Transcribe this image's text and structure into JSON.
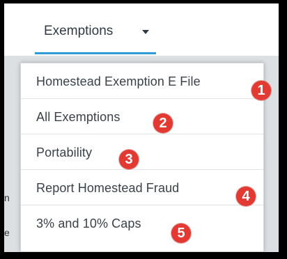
{
  "nav": {
    "tab_label": "Exemptions",
    "accent_color": "#2e9bd6",
    "caret_icon": "caret-down-icon"
  },
  "menu": {
    "items": [
      {
        "label": "Homestead Exemption E File",
        "badge": "1"
      },
      {
        "label": "All Exemptions",
        "badge": "2"
      },
      {
        "label": "Portability",
        "badge": "3"
      },
      {
        "label": "Report Homestead Fraud",
        "badge": "4"
      },
      {
        "label": "3% and 10% Caps",
        "badge": "5"
      }
    ],
    "badge_color": "#e23a32"
  },
  "background_fragments": [
    "n",
    "e"
  ]
}
